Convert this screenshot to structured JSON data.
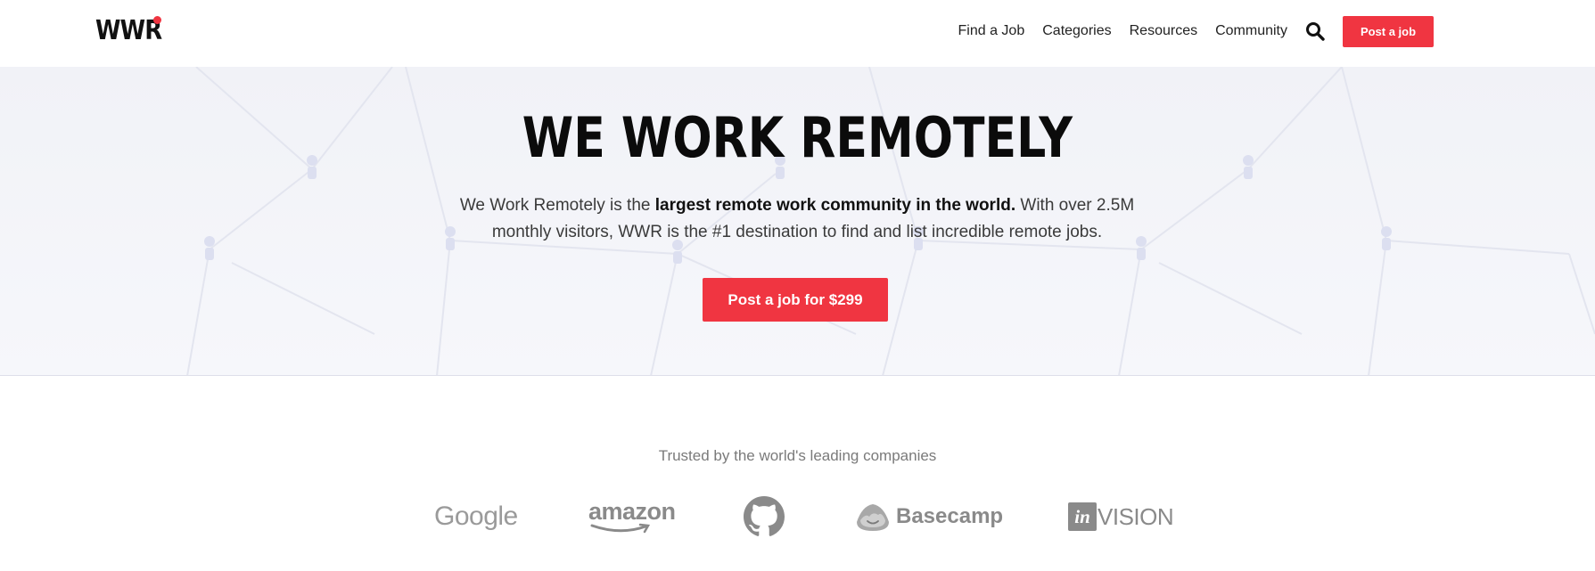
{
  "header": {
    "logo_text": "WWR",
    "nav": [
      {
        "label": "Find a Job"
      },
      {
        "label": "Categories"
      },
      {
        "label": "Resources"
      },
      {
        "label": "Community"
      }
    ],
    "search_icon": "search-icon",
    "post_button_label": "Post a job"
  },
  "hero": {
    "title": "WE WORK REMOTELY",
    "desc_prefix": "We Work Remotely is the ",
    "desc_bold": "largest remote work community in the world.",
    "desc_suffix": " With over 2.5M monthly visitors, WWR is the #1 destination to find and list incredible remote jobs.",
    "cta_label": "Post a job for $299"
  },
  "trusted": {
    "title": "Trusted by the world's leading companies",
    "companies": [
      {
        "name": "Google"
      },
      {
        "name": "amazon"
      },
      {
        "name": "GitHub",
        "icon": "github-icon"
      },
      {
        "name": "Basecamp"
      },
      {
        "name": "InVision",
        "mark": "in",
        "text": "VISION"
      }
    ]
  },
  "colors": {
    "accent": "#f03541",
    "hero_bg": "#f3f4f9",
    "logo_gray": "#8a8a8a"
  }
}
